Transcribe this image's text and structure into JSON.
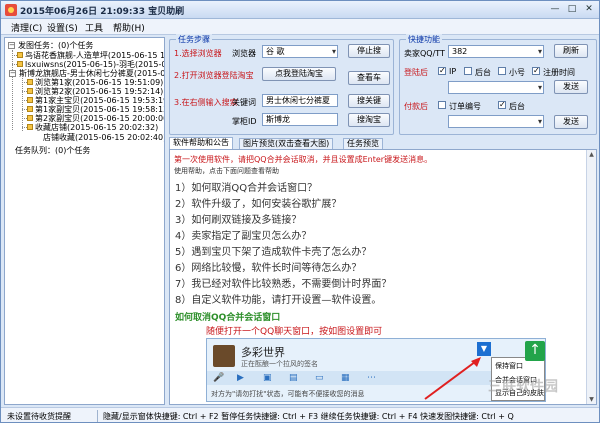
{
  "app": {
    "title": "2015年06月26日 21:09:33   宝贝助刷"
  },
  "menu": [
    "清理(C)",
    "设置(S)",
    "工具",
    "帮助(H)"
  ],
  "tree": {
    "root": "发图任务：(0)个任务",
    "items": [
      "鸟语花香旗舰-人造草坪(2015-06-15 13:2",
      "lsxuiwsns(2015-06-15)-羽毛(2015-06-15 17:41:5",
      "斯博龙旗舰店-男士休闲七分裤夏(2015-06-1",
      "浏览第1家(2015-06-15 19:51:09)",
      "浏览第2家(2015-06-15 19:52:14)",
      "第1家主宝贝(2015-06-15 19:53:19)",
      "第1家副宝贝(2015-06-15 19:58:13)",
      "第2家副宝贝(2015-06-15 20:00:00)",
      "收藏店铺(2015-06-15 20:02:32)",
      "店铺收藏(2015-06-15 20:02:40)"
    ],
    "queue": "任务队列：(0)个任务"
  },
  "steps": {
    "legend": "任务步骤",
    "step1": "1.选择浏览器",
    "browser_label": "浏览器",
    "browser_value": "谷 歌",
    "stop_search": "停止搜",
    "step2": "2.打开浏览器登陆淘宝",
    "open_taobao": "点我登陆淘宝",
    "view_cart": "查看车",
    "step3": "3.在右侧输入搜索",
    "keyword_label": "关键词",
    "keyword_value": "男士休闲七分裤夏",
    "search_btn": "搜关键",
    "seller_label": "掌柜ID",
    "seller_value": "斯博龙",
    "search_taobao": "搜淘宝"
  },
  "quick": {
    "legend": "快捷功能",
    "qq_label": "卖家QQ/TT",
    "qq_value": "382",
    "refresh": "刷新",
    "login_after": "登陆后",
    "opt_ip": "IP",
    "opt_backend": "后台",
    "opt_xiaohao": "小号",
    "opt_register": "注册时间",
    "send1": "发送",
    "pay_after": "付款后",
    "opt_order": "订单编号",
    "opt_backend2": "后台",
    "send2": "发送"
  },
  "tabs": [
    "软件帮助和公告",
    "图片预览(双击查看大图)",
    "任务预览"
  ],
  "help": {
    "top_line": "第一次使用软件，请把QQ合并会话取消，并且设置成Enter键发送消息。",
    "hint": "使用帮助，点击下面问题查看帮助",
    "questions": [
      "1）如何取消QQ合并会话窗口？",
      "2）软件升级了，如何安装谷歌扩展？",
      "3）如何刷双链接及多链接？",
      "4）卖家指定了副宝贝怎么办？",
      "5）遇到宝贝下架了造成软件卡壳了怎么办？",
      "6）网络比较慢，软件长时间等待怎么办？",
      "7）我已经对软件比较熟悉，不需要倒计时界面？",
      "8）自定义软件功能，请打开设置—软件设置。"
    ],
    "subheading": "如何取消QQ合并会话窗口",
    "subnote": "随便打开一个QQ聊天窗口，按如图设置即可",
    "shot_title": "多彩世界",
    "shot_status": "正在酝酿一个拉风的签名",
    "shot_menu": [
      "保持窗口",
      "合并会话窗口",
      "显示自己的皮肤"
    ],
    "shot_footer": "对方为\"请勿打扰\"状态，可能有不便接收您的消息"
  },
  "status": {
    "seg1": "未设置待收货提醒",
    "seg2": "隐藏/显示窗体快捷键: Ctrl + F2  暂停任务快捷键: Ctrl + F3  继续任务快捷键: Ctrl + F4  快速发图快捷键: Ctrl + Q"
  },
  "watermark": "三联软件园"
}
